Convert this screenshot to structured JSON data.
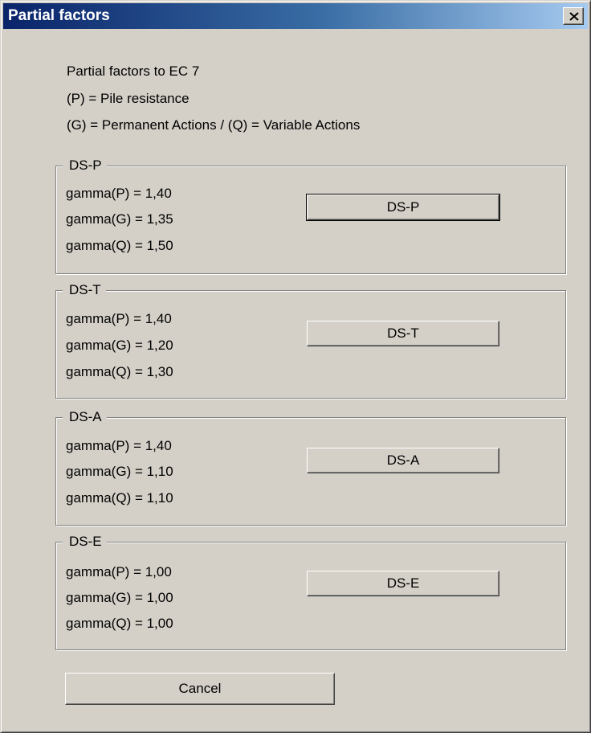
{
  "window": {
    "title": "Partial factors",
    "close_label": "X"
  },
  "intro": {
    "line1": "Partial factors to EC 7",
    "line2": "(P) = Pile resistance",
    "line3": "(G) = Permanent Actions / (Q) = Variable Actions"
  },
  "groups": [
    {
      "legend": "DS-P",
      "gamma_p": "gamma(P) = 1,40",
      "gamma_g": "gamma(G) = 1,35",
      "gamma_q": "gamma(Q) = 1,50",
      "button_label": "DS-P"
    },
    {
      "legend": "DS-T",
      "gamma_p": "gamma(P) = 1,40",
      "gamma_g": "gamma(G) = 1,20",
      "gamma_q": "gamma(Q) = 1,30",
      "button_label": "DS-T"
    },
    {
      "legend": "DS-A",
      "gamma_p": "gamma(P) = 1,40",
      "gamma_g": "gamma(G) = 1,10",
      "gamma_q": "gamma(Q) = 1,10",
      "button_label": "DS-A"
    },
    {
      "legend": "DS-E",
      "gamma_p": "gamma(P) = 1,00",
      "gamma_g": "gamma(G) = 1,00",
      "gamma_q": "gamma(Q) = 1,00",
      "button_label": "DS-E"
    }
  ],
  "footer": {
    "cancel_label": "Cancel"
  }
}
